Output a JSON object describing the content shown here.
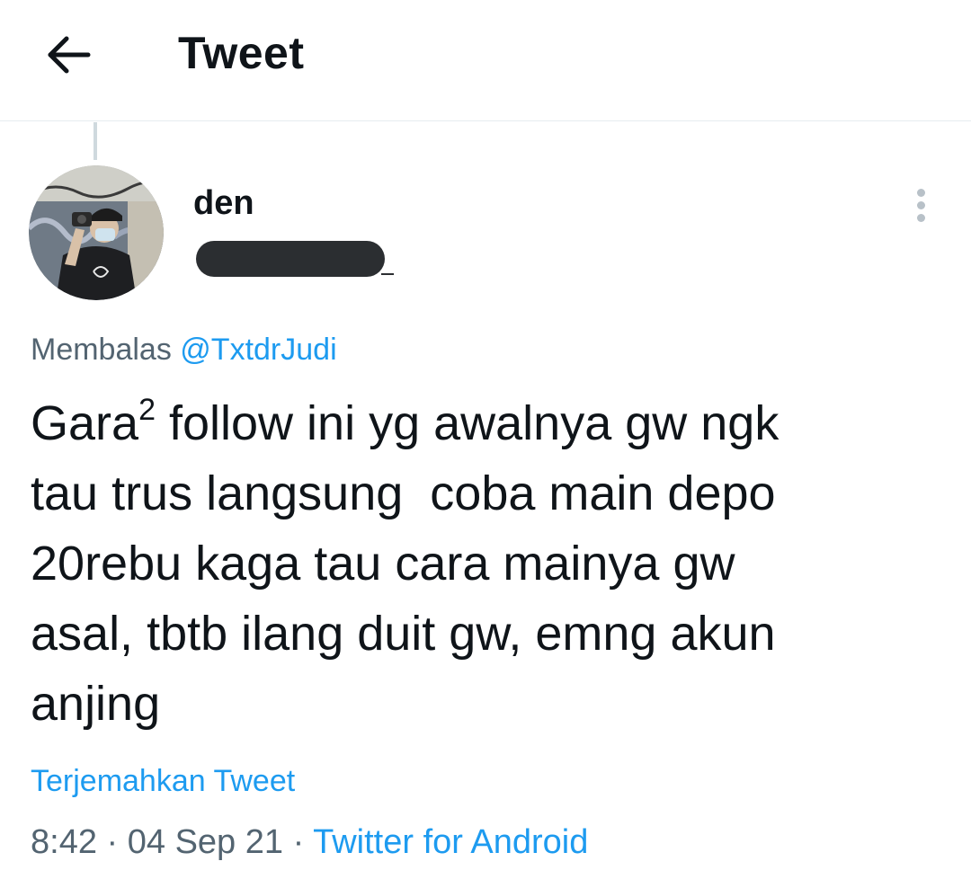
{
  "header": {
    "back_icon": "arrow-left-icon",
    "title": "Tweet"
  },
  "tweet": {
    "author": {
      "display_name": "den",
      "avatar_icon": "user-avatar-photo"
    },
    "more_icon": "vertical-dots-icon",
    "reply_prefix": "Membalas",
    "reply_handle": "@TxtdrJudi",
    "text_before_sup": "Gara",
    "text_sup": "2",
    "text_after_sup": " follow ini yg awalnya gw ngk\ntau trus langsung  coba main depo\n20rebu kaga tau cara mainya gw\nasal, tbtb ilang duit gw, emng akun\nanjing",
    "translate_label": "Terjemahkan Tweet",
    "time": "8:42",
    "separator": " · ",
    "date": "04 Sep 21",
    "source": "Twitter for Android"
  },
  "colors": {
    "accent": "#1d9bf0",
    "muted": "#536471",
    "text": "#0f1419"
  }
}
